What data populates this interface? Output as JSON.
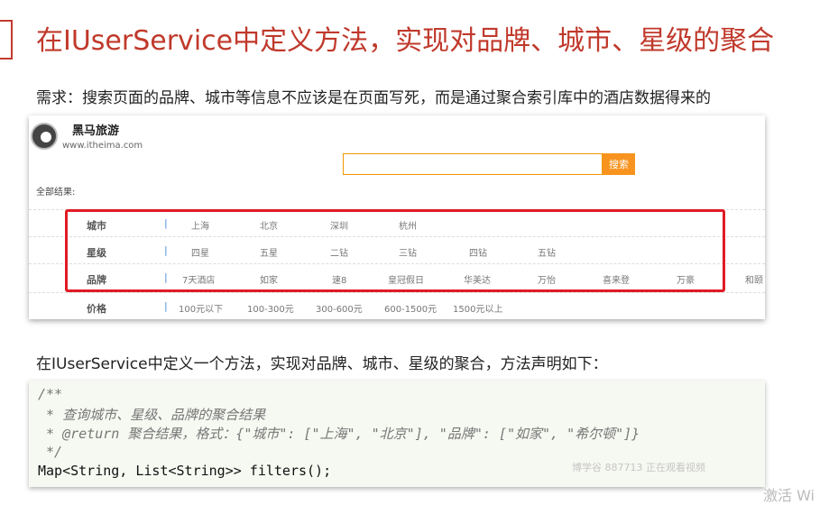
{
  "slide": {
    "title": "在IUserService中定义方法，实现对品牌、城市、星级的聚合",
    "requirement": "需求：搜索页面的品牌、城市等信息不应该是在页面写死，而是通过聚合索引库中的酒店数据得来的",
    "sub_heading": "在IUserService中定义一个方法，实现对品牌、城市、星级的聚合，方法声明如下："
  },
  "screenshot": {
    "brand_name": "黑马旅游",
    "brand_url": "www.itheima.com",
    "search_button": "搜索",
    "all_results": "全部结果:",
    "filters": {
      "city": {
        "label": "城市",
        "sep": "|",
        "options": [
          "上海",
          "北京",
          "深圳",
          "杭州"
        ]
      },
      "star": {
        "label": "星级",
        "sep": "|",
        "options": [
          "四星",
          "五星",
          "二钻",
          "三钻",
          "四钻",
          "五钻"
        ]
      },
      "brand": {
        "label": "品牌",
        "sep": "|",
        "options": [
          "7天酒店",
          "如家",
          "速8",
          "皇冠假日",
          "华美达",
          "万怡",
          "喜来登",
          "万豪",
          "和颐"
        ]
      },
      "price": {
        "label": "价格",
        "sep": "|",
        "options": [
          "100元以下",
          "100-300元",
          "300-600元",
          "600-1500元",
          "1500元以上"
        ]
      }
    }
  },
  "code": {
    "line1": "/**",
    "line2": " * 查询城市、星级、品牌的聚合结果",
    "line3": " * @return 聚合结果，格式：{\"城市\": [\"上海\", \"北京\"], \"品牌\": [\"如家\", \"希尔顿\"]}",
    "line4": " */",
    "line5": "Map<String, List<String>> filters();"
  },
  "overlay": {
    "watermark": "博学谷 887713 正在观看视频",
    "activate": "激活 Wi"
  },
  "colors": {
    "title_red": "#c0392b",
    "highlight_red": "#e01b24",
    "search_orange": "#f7931e",
    "separator_blue": "#4a8fd6"
  }
}
